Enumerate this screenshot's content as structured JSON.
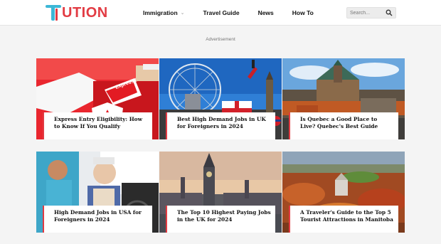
{
  "header": {
    "logo_text": "UTION",
    "nav": [
      {
        "label": "Immigration",
        "caret": "⌄"
      },
      {
        "label": "Travel Guide"
      },
      {
        "label": "News"
      },
      {
        "label": "How To"
      }
    ],
    "search_placeholder": "Search..."
  },
  "advertisement_label": "Advertisement",
  "articles": [
    {
      "title": "Express Entry Eligibility: How to Know If You Qualify",
      "image_text": "Express Entry"
    },
    {
      "title": "Best High Demand Jobs in UK for Foreigners in 2024"
    },
    {
      "title": "Is Quebec a Good Place to Live? Quebec's Best Guide"
    },
    {
      "title": "High Demand Jobs in USA for Foreigners in 2024"
    },
    {
      "title": "The Top 10 Highest Paying Jobs in the UK for 2024"
    },
    {
      "title": "A Traveler's Guide to the Top 5 Tourist Attractions in Manitoba"
    }
  ],
  "colors": {
    "brand_red": "#e23b43",
    "brand_blue": "#3cb7d6"
  }
}
